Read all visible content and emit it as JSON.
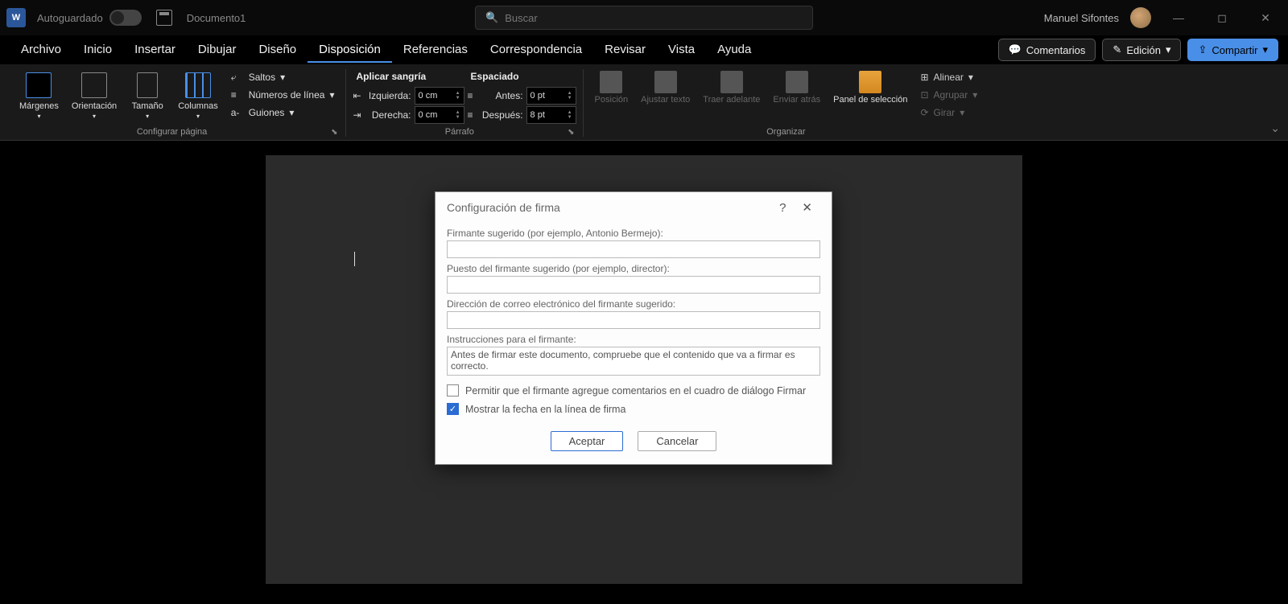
{
  "titlebar": {
    "autosave_label": "Autoguardado",
    "document_name": "Documento1",
    "search_placeholder": "Buscar",
    "username": "Manuel Sifontes"
  },
  "tabs": {
    "items": [
      "Archivo",
      "Inicio",
      "Insertar",
      "Dibujar",
      "Diseño",
      "Disposición",
      "Referencias",
      "Correspondencia",
      "Revisar",
      "Vista",
      "Ayuda"
    ],
    "active_index": 5,
    "comments": "Comentarios",
    "editing": "Edición",
    "share": "Compartir"
  },
  "ribbon": {
    "page_setup": {
      "margins": "Márgenes",
      "orientation": "Orientación",
      "size": "Tamaño",
      "columns": "Columnas",
      "breaks": "Saltos",
      "line_numbers": "Números de línea",
      "hyphenation": "Guiones",
      "group_label": "Configurar página"
    },
    "paragraph": {
      "indent_title": "Aplicar sangría",
      "left_label": "Izquierda:",
      "right_label": "Derecha:",
      "left_val": "0 cm",
      "right_val": "0 cm",
      "spacing_title": "Espaciado",
      "before_label": "Antes:",
      "after_label": "Después:",
      "before_val": "0 pt",
      "after_val": "8 pt",
      "group_label": "Párrafo"
    },
    "arrange": {
      "position": "Posición",
      "wrap": "Ajustar texto",
      "bring_forward": "Traer adelante",
      "send_backward": "Enviar atrás",
      "selection_pane": "Panel de selección",
      "align": "Alinear",
      "group": "Agrupar",
      "rotate": "Girar",
      "group_label": "Organizar"
    }
  },
  "dialog": {
    "title": "Configuración de firma",
    "signer_label": "Firmante sugerido (por ejemplo, Antonio Bermejo):",
    "signer_value": "",
    "title_label": "Puesto del firmante sugerido (por ejemplo, director):",
    "title_value": "",
    "email_label": "Dirección de correo electrónico del firmante sugerido:",
    "email_value": "",
    "instructions_label": "Instrucciones para el firmante:",
    "instructions_value": "Antes de firmar este documento, compruebe que el contenido que va a firmar es correcto.",
    "allow_comments": "Permitir que el firmante agregue comentarios en el cuadro de diálogo Firmar",
    "show_date": "Mostrar la fecha en la línea de firma",
    "ok": "Aceptar",
    "cancel": "Cancelar"
  }
}
